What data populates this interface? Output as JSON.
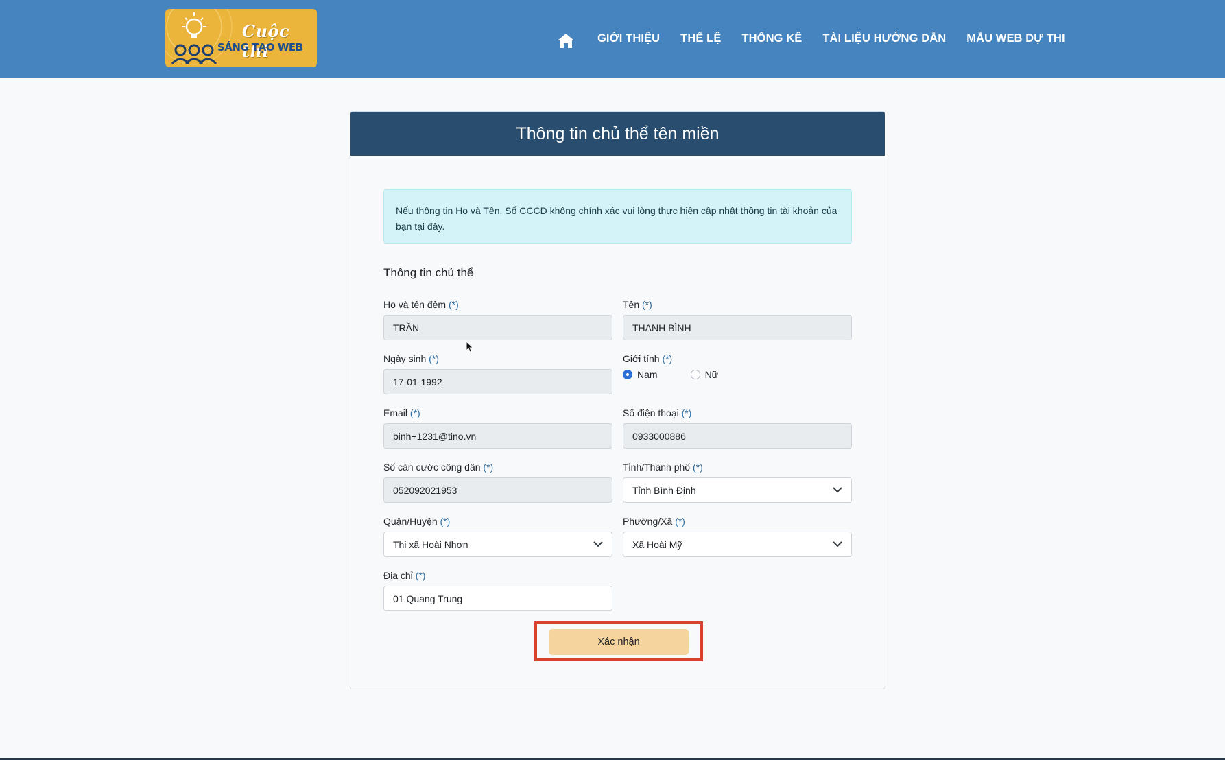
{
  "header": {
    "logo": {
      "line1": "Cuộc thi",
      "line2": "SÁNG TẠO WEB"
    },
    "nav": {
      "home_icon": "home-icon",
      "items": [
        "GIỚI THIỆU",
        "THỂ LỆ",
        "THỐNG KÊ",
        "TÀI LIỆU HƯỚNG DẪN",
        "MẪU WEB DỰ THI"
      ]
    }
  },
  "card": {
    "title": "Thông tin chủ thể tên miền",
    "notice": "Nếu thông tin Họ và Tên, Số CCCD không chính xác vui lòng thực hiện cập nhật thông tin tài khoản của bạn tại đây.",
    "section_title": "Thông tin chủ thể",
    "required_mark": "(*)",
    "fields": {
      "middle_name": {
        "label": "Họ và tên đệm",
        "value": "TRẦN"
      },
      "first_name": {
        "label": "Tên",
        "value": "THANH BÌNH"
      },
      "birthdate": {
        "label": "Ngày sinh",
        "value": "17-01-1992"
      },
      "gender": {
        "label": "Giới tính",
        "options": [
          "Nam",
          "Nữ"
        ],
        "selected": "Nam"
      },
      "email": {
        "label": "Email",
        "value": "binh+1231@tino.vn"
      },
      "phone": {
        "label": "Số điện thoại",
        "value": "0933000886"
      },
      "id_number": {
        "label": "Số căn cước công dân",
        "value": "052092021953"
      },
      "province": {
        "label": "Tỉnh/Thành phố",
        "value": "Tỉnh Bình Định"
      },
      "district": {
        "label": "Quận/Huyện",
        "value": "Thị xã Hoài Nhơn"
      },
      "ward": {
        "label": "Phường/Xã",
        "value": "Xã Hoài Mỹ"
      },
      "address": {
        "label": "Địa chỉ",
        "value": "01 Quang Trung"
      }
    },
    "submit_label": "Xác nhận"
  },
  "colors": {
    "header_bg": "#4584bf",
    "card_header_bg": "#284d6e",
    "button_bg": "#f5d49d",
    "highlight_border": "#d9432e",
    "notice_bg": "#d4f3f9"
  }
}
